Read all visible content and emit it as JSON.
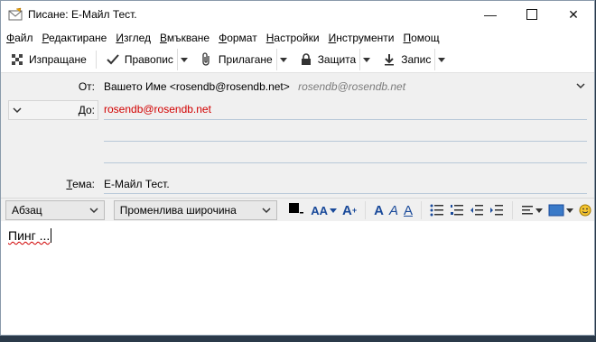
{
  "window": {
    "title": "Писане: Е-Майл Тест."
  },
  "menu": [
    {
      "pre": "",
      "u": "Ф",
      "post": "айл"
    },
    {
      "pre": "",
      "u": "Р",
      "post": "едактиране"
    },
    {
      "pre": "",
      "u": "И",
      "post": "зглед"
    },
    {
      "pre": "",
      "u": "В",
      "post": "мъкване"
    },
    {
      "pre": "",
      "u": "Ф",
      "post": "ормат"
    },
    {
      "pre": "",
      "u": "Н",
      "post": "астройки"
    },
    {
      "pre": "",
      "u": "И",
      "post": "нструменти"
    },
    {
      "pre": "",
      "u": "П",
      "post": "омощ"
    }
  ],
  "toolbar": {
    "send": "Изпращане",
    "spelling": "Правопис",
    "attach": "Прилагане",
    "security": "Защита",
    "save": "Запис"
  },
  "headers": {
    "from_label": "От:",
    "from_value": "Вашето Име <rosendb@rosendb.net>",
    "from_hint": "rosendb@rosendb.net",
    "to_label": "До:",
    "to_value": "rosendb@rosendb.net",
    "subject_label": "Тема:",
    "subject_value": "Е-Майл Тест."
  },
  "format": {
    "paragraph": "Абзац",
    "font": "Променлива широчина"
  },
  "body": {
    "text": "Пинг ..."
  },
  "colors": {
    "address_red": "#d20000",
    "format_blue": "#1a4a9a"
  }
}
